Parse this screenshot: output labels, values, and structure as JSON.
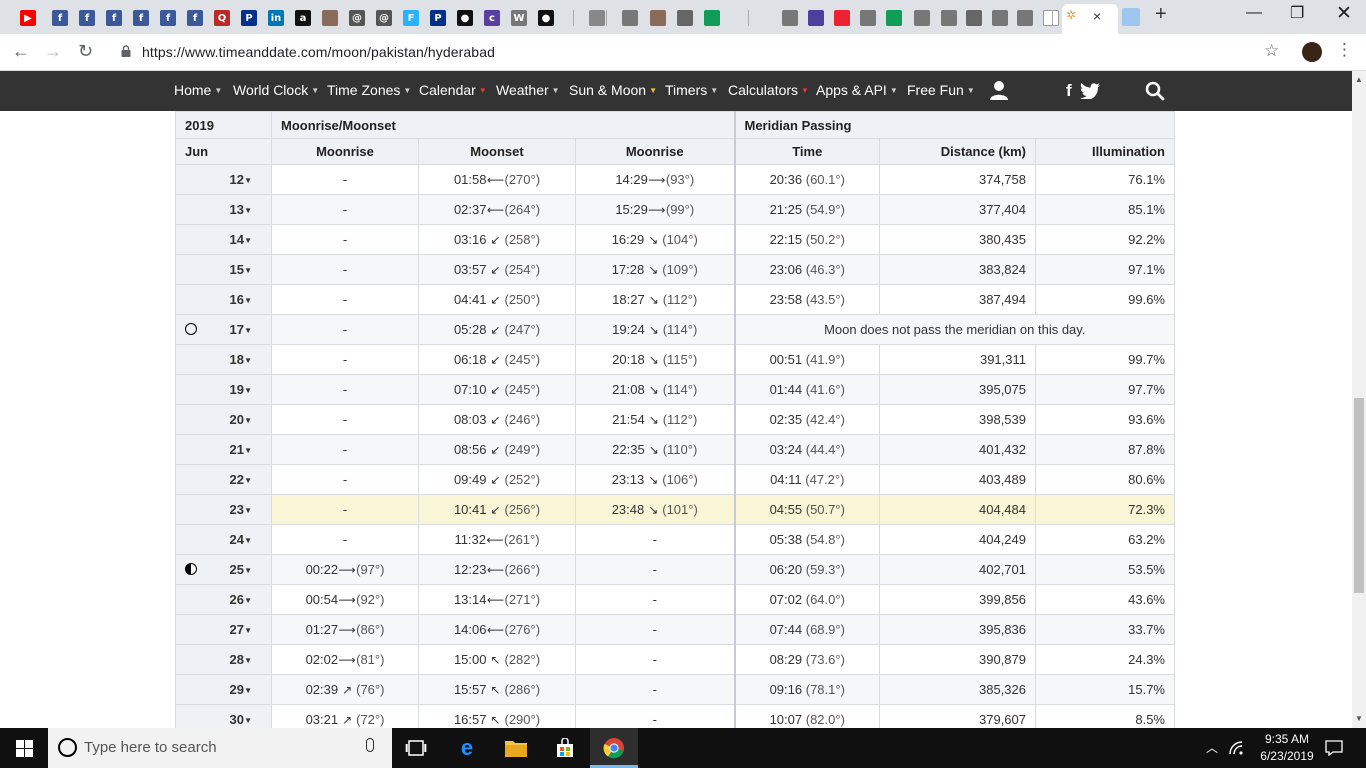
{
  "browser": {
    "url": "https://www.timeanddate.com/moon/pakistan/hyderabad",
    "tab_close": "×",
    "new_tab": "+",
    "tabs": [
      {
        "icon": "youtube-icon",
        "color": "#ff0000",
        "glyph": "▶"
      },
      {
        "icon": "facebook-icon",
        "color": "#3b5998",
        "glyph": "f"
      },
      {
        "icon": "facebook-icon",
        "color": "#3b5998",
        "glyph": "f"
      },
      {
        "icon": "facebook-icon",
        "color": "#3b5998",
        "glyph": "f"
      },
      {
        "icon": "facebook-icon",
        "color": "#3b5998",
        "glyph": "f"
      },
      {
        "icon": "facebook-icon",
        "color": "#3b5998",
        "glyph": "f"
      },
      {
        "icon": "facebook-icon",
        "color": "#3b5998",
        "glyph": "f"
      },
      {
        "icon": "quora-icon",
        "color": "#b92b27",
        "glyph": "Q"
      },
      {
        "icon": "paypal-icon",
        "color": "#003087",
        "glyph": "P"
      },
      {
        "icon": "linkedin-icon",
        "color": "#0077b5",
        "glyph": "in"
      },
      {
        "icon": "amazon-icon",
        "color": "#111111",
        "glyph": "a"
      },
      {
        "icon": "photo-icon",
        "color": "#8a6a5a",
        "glyph": ""
      },
      {
        "icon": "swirl-icon",
        "color": "#555555",
        "glyph": "@"
      },
      {
        "icon": "swirl-icon",
        "color": "#555555",
        "glyph": "@"
      },
      {
        "icon": "freelancer-icon",
        "color": "#29b2fe",
        "glyph": "F"
      },
      {
        "icon": "paypal-icon",
        "color": "#003087",
        "glyph": "P"
      },
      {
        "icon": "github-icon",
        "color": "#111111",
        "glyph": "●"
      },
      {
        "icon": "coinbase-icon",
        "color": "#5a3fa0",
        "glyph": "c"
      },
      {
        "icon": "wordpress-icon",
        "color": "#777777",
        "glyph": "W"
      },
      {
        "icon": "github-icon",
        "color": "#111111",
        "glyph": "●"
      }
    ],
    "user_avatar": "user-avatar-icon"
  },
  "site_nav": {
    "items": [
      {
        "label": "Home"
      },
      {
        "label": "World Clock"
      },
      {
        "label": "Time Zones"
      },
      {
        "label": "Calendar"
      },
      {
        "label": "Weather"
      },
      {
        "label": "Sun & Moon"
      },
      {
        "label": "Timers"
      },
      {
        "label": "Calculators"
      },
      {
        "label": "Apps & API"
      },
      {
        "label": "Free Fun"
      }
    ],
    "caret": "▼"
  },
  "table": {
    "year": "2019",
    "month": "Jun",
    "group_rise_set": "Moonrise/Moonset",
    "group_meridian": "Meridian Passing",
    "col_moonrise_1": "Moonrise",
    "col_moonset": "Moonset",
    "col_moonrise_2": "Moonrise",
    "col_time": "Time",
    "col_distance": "Distance (km)",
    "col_illumination": "Illumination",
    "caret": "▼",
    "no_meridian_text": "Moon does not pass the meridian on this day.",
    "rows": [
      {
        "day": "12",
        "rise1": "-",
        "rise1_deg": "",
        "set": "01:58",
        "set_arrow": "⟵",
        "set_deg": "(270°)",
        "rise2": "14:29",
        "rise2_arrow": "⟶",
        "rise2_deg": "(93°)",
        "time": "20:36",
        "time_deg": "(60.1°)",
        "distance": "374,758",
        "illum": "76.1%"
      },
      {
        "day": "13",
        "rise1": "-",
        "rise1_deg": "",
        "set": "02:37",
        "set_arrow": "⟵",
        "set_deg": "(264°)",
        "rise2": "15:29",
        "rise2_arrow": "⟶",
        "rise2_deg": "(99°)",
        "time": "21:25",
        "time_deg": "(54.9°)",
        "distance": "377,404",
        "illum": "85.1%"
      },
      {
        "day": "14",
        "rise1": "-",
        "rise1_deg": "",
        "set": "03:16",
        "set_arrow": "↙",
        "set_deg": "(258°)",
        "rise2": "16:29",
        "rise2_arrow": "↘",
        "rise2_deg": "(104°)",
        "time": "22:15",
        "time_deg": "(50.2°)",
        "distance": "380,435",
        "illum": "92.2%"
      },
      {
        "day": "15",
        "rise1": "-",
        "rise1_deg": "",
        "set": "03:57",
        "set_arrow": "↙",
        "set_deg": "(254°)",
        "rise2": "17:28",
        "rise2_arrow": "↘",
        "rise2_deg": "(109°)",
        "time": "23:06",
        "time_deg": "(46.3°)",
        "distance": "383,824",
        "illum": "97.1%"
      },
      {
        "day": "16",
        "rise1": "-",
        "rise1_deg": "",
        "set": "04:41",
        "set_arrow": "↙",
        "set_deg": "(250°)",
        "rise2": "18:27",
        "rise2_arrow": "↘",
        "rise2_deg": "(112°)",
        "time": "23:58",
        "time_deg": "(43.5°)",
        "distance": "387,494",
        "illum": "99.6%"
      },
      {
        "day": "17",
        "phase": "full",
        "rise1": "-",
        "rise1_deg": "",
        "set": "05:28",
        "set_arrow": "↙",
        "set_deg": "(247°)",
        "rise2": "19:24",
        "rise2_arrow": "↘",
        "rise2_deg": "(114°)",
        "no_meridian": true
      },
      {
        "day": "18",
        "rise1": "-",
        "rise1_deg": "",
        "set": "06:18",
        "set_arrow": "↙",
        "set_deg": "(245°)",
        "rise2": "20:18",
        "rise2_arrow": "↘",
        "rise2_deg": "(115°)",
        "time": "00:51",
        "time_deg": "(41.9°)",
        "distance": "391,311",
        "illum": "99.7%"
      },
      {
        "day": "19",
        "rise1": "-",
        "rise1_deg": "",
        "set": "07:10",
        "set_arrow": "↙",
        "set_deg": "(245°)",
        "rise2": "21:08",
        "rise2_arrow": "↘",
        "rise2_deg": "(114°)",
        "time": "01:44",
        "time_deg": "(41.6°)",
        "distance": "395,075",
        "illum": "97.7%"
      },
      {
        "day": "20",
        "rise1": "-",
        "rise1_deg": "",
        "set": "08:03",
        "set_arrow": "↙",
        "set_deg": "(246°)",
        "rise2": "21:54",
        "rise2_arrow": "↘",
        "rise2_deg": "(112°)",
        "time": "02:35",
        "time_deg": "(42.4°)",
        "distance": "398,539",
        "illum": "93.6%"
      },
      {
        "day": "21",
        "rise1": "-",
        "rise1_deg": "",
        "set": "08:56",
        "set_arrow": "↙",
        "set_deg": "(249°)",
        "rise2": "22:35",
        "rise2_arrow": "↘",
        "rise2_deg": "(110°)",
        "time": "03:24",
        "time_deg": "(44.4°)",
        "distance": "401,432",
        "illum": "87.8%"
      },
      {
        "day": "22",
        "rise1": "-",
        "rise1_deg": "",
        "set": "09:49",
        "set_arrow": "↙",
        "set_deg": "(252°)",
        "rise2": "23:13",
        "rise2_arrow": "↘",
        "rise2_deg": "(106°)",
        "time": "04:11",
        "time_deg": "(47.2°)",
        "distance": "403,489",
        "illum": "80.6%"
      },
      {
        "day": "23",
        "today": true,
        "rise1": "-",
        "rise1_deg": "",
        "set": "10:41",
        "set_arrow": "↙",
        "set_deg": "(256°)",
        "rise2": "23:48",
        "rise2_arrow": "↘",
        "rise2_deg": "(101°)",
        "time": "04:55",
        "time_deg": "(50.7°)",
        "distance": "404,484",
        "illum": "72.3%"
      },
      {
        "day": "24",
        "rise1": "-",
        "rise1_deg": "",
        "set": "11:32",
        "set_arrow": "⟵",
        "set_deg": "(261°)",
        "rise2": "-",
        "rise2_arrow": "",
        "rise2_deg": "",
        "time": "05:38",
        "time_deg": "(54.8°)",
        "distance": "404,249",
        "illum": "63.2%"
      },
      {
        "day": "25",
        "phase": "half",
        "rise1": "00:22",
        "rise1_arrow": "⟶",
        "rise1_deg": "(97°)",
        "set": "12:23",
        "set_arrow": "⟵",
        "set_deg": "(266°)",
        "rise2": "-",
        "rise2_arrow": "",
        "rise2_deg": "",
        "time": "06:20",
        "time_deg": "(59.3°)",
        "distance": "402,701",
        "illum": "53.5%"
      },
      {
        "day": "26",
        "rise1": "00:54",
        "rise1_arrow": "⟶",
        "rise1_deg": "(92°)",
        "set": "13:14",
        "set_arrow": "⟵",
        "set_deg": "(271°)",
        "rise2": "-",
        "rise2_arrow": "",
        "rise2_deg": "",
        "time": "07:02",
        "time_deg": "(64.0°)",
        "distance": "399,856",
        "illum": "43.6%"
      },
      {
        "day": "27",
        "rise1": "01:27",
        "rise1_arrow": "⟶",
        "rise1_deg": "(86°)",
        "set": "14:06",
        "set_arrow": "⟵",
        "set_deg": "(276°)",
        "rise2": "-",
        "rise2_arrow": "",
        "rise2_deg": "",
        "time": "07:44",
        "time_deg": "(68.9°)",
        "distance": "395,836",
        "illum": "33.7%"
      },
      {
        "day": "28",
        "rise1": "02:02",
        "rise1_arrow": "⟶",
        "rise1_deg": "(81°)",
        "set": "15:00",
        "set_arrow": "↖",
        "set_deg": "(282°)",
        "rise2": "-",
        "rise2_arrow": "",
        "rise2_deg": "",
        "time": "08:29",
        "time_deg": "(73.6°)",
        "distance": "390,879",
        "illum": "24.3%"
      },
      {
        "day": "29",
        "rise1": "02:39",
        "rise1_arrow": "↗",
        "rise1_deg": "(76°)",
        "set": "15:57",
        "set_arrow": "↖",
        "set_deg": "(286°)",
        "rise2": "-",
        "rise2_arrow": "",
        "rise2_deg": "",
        "time": "09:16",
        "time_deg": "(78.1°)",
        "distance": "385,326",
        "illum": "15.7%"
      },
      {
        "day": "30",
        "rise1": "03:21",
        "rise1_arrow": "↗",
        "rise1_deg": "(72°)",
        "set": "16:57",
        "set_arrow": "↖",
        "set_deg": "(290°)",
        "rise2": "-",
        "rise2_arrow": "",
        "rise2_deg": "",
        "time": "10:07",
        "time_deg": "(82.0°)",
        "distance": "379,607",
        "illum": "8.5%"
      }
    ]
  },
  "taskbar": {
    "search_placeholder": "Type here to search",
    "time": "9:35 AM",
    "date": "6/23/2019"
  }
}
